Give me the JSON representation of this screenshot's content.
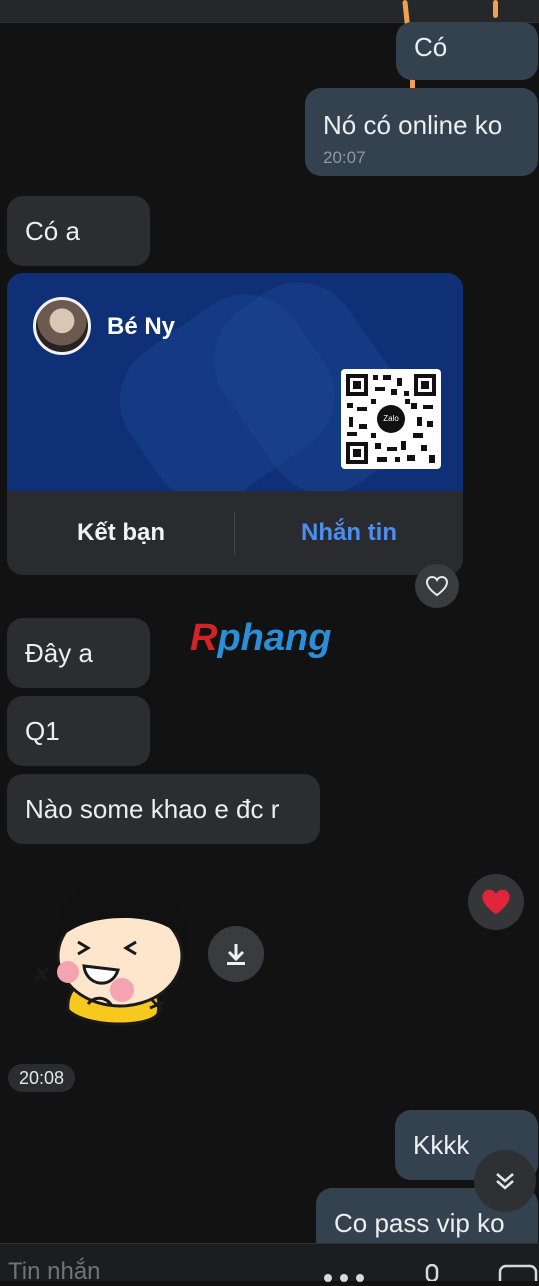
{
  "messages": {
    "out_co": "Có",
    "out_online": "Nó có online ko",
    "out_online_time": "20:07",
    "in_coa": "Có a",
    "in_daya": "Đây a",
    "in_q1": "Q1",
    "in_nao": "Nào some khao e đc r",
    "out_kkkk": "Kkkk",
    "out_pass": "Co pass vip ko"
  },
  "contact_card": {
    "name": "Bé Ny",
    "add_friend_label": "Kết bạn",
    "message_label": "Nhắn tin",
    "qr_logo": "Zalo"
  },
  "watermark": {
    "part1": "R",
    "part2": "phang"
  },
  "sticker_time": "20:08",
  "composer": {
    "placeholder": "Tin nhắn"
  },
  "colors": {
    "card_blue": "#0f3077",
    "link_blue": "#4b8ef0",
    "heart_red": "#e0243a"
  },
  "icons": [
    "heart-outline-icon",
    "heart-filled-icon",
    "download-icon",
    "scroll-down-icon"
  ]
}
